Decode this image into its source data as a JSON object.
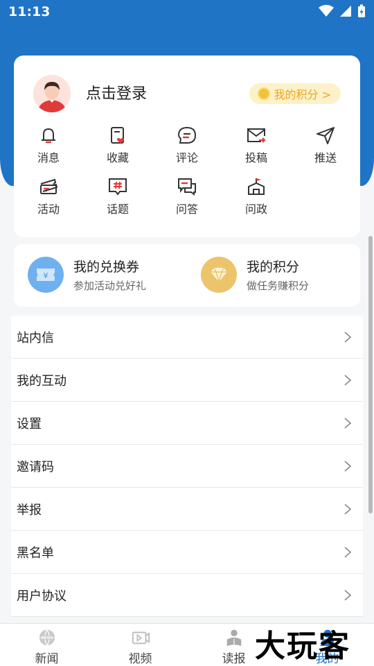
{
  "status_bar": {
    "time": "11:13"
  },
  "user": {
    "login_prompt": "点击登录",
    "points_button": "我的积分 >"
  },
  "quick_grid": [
    [
      {
        "label": "消息",
        "icon": "bell-icon"
      },
      {
        "label": "收藏",
        "icon": "favorite-doc-icon"
      },
      {
        "label": "评论",
        "icon": "comment-icon"
      },
      {
        "label": "投稿",
        "icon": "mail-send-icon"
      },
      {
        "label": "推送",
        "icon": "paper-plane-icon"
      }
    ],
    [
      {
        "label": "活动",
        "icon": "ticket-icon"
      },
      {
        "label": "话题",
        "icon": "hashtag-icon"
      },
      {
        "label": "问答",
        "icon": "qa-icon"
      },
      {
        "label": "问政",
        "icon": "building-flag-icon"
      }
    ]
  ],
  "promos": {
    "voucher": {
      "title": "我的兑换券",
      "subtitle": "参加活动兑好礼",
      "icon": "voucher-icon",
      "color": "#6fb1ee"
    },
    "points": {
      "title": "我的积分",
      "subtitle": "做任务赚积分",
      "icon": "diamond-icon",
      "color": "#ecc46c"
    }
  },
  "menu": [
    "站内信",
    "我的互动",
    "设置",
    "邀请码",
    "举报",
    "黑名单",
    "用户协议"
  ],
  "tabs": [
    {
      "label": "新闻",
      "icon": "globe-news-icon"
    },
    {
      "label": "视频",
      "icon": "video-icon"
    },
    {
      "label": "读报",
      "icon": "reader-icon"
    },
    {
      "label": "我的",
      "icon": "user-icon",
      "active": true
    }
  ],
  "watermark": "大玩客",
  "colors": {
    "brand_blue": "#1f74c6",
    "accent_gold": "#e9a61f",
    "accent_red": "#e53935"
  }
}
